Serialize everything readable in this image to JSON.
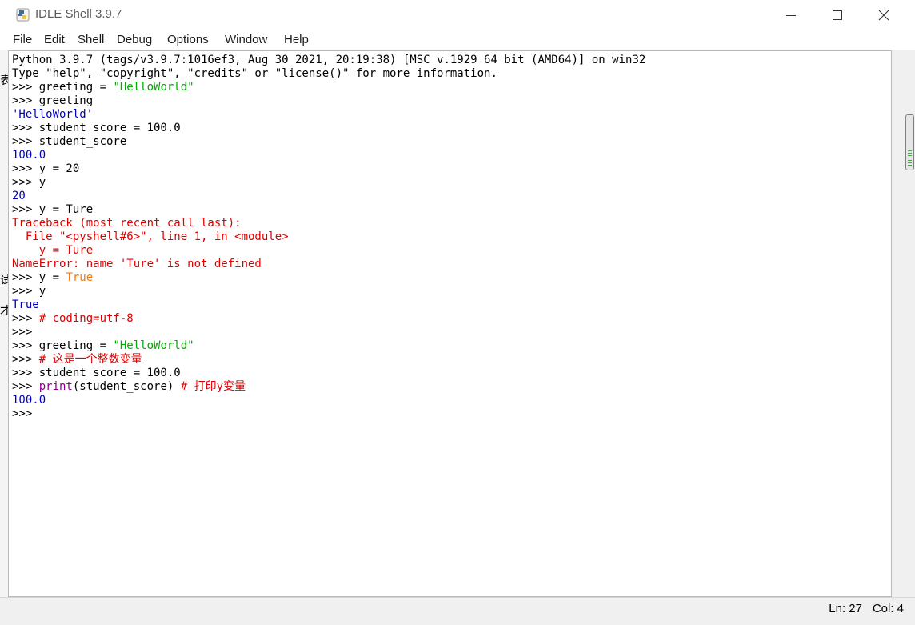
{
  "window": {
    "title": "IDLE Shell 3.9.7"
  },
  "menu": [
    "File",
    "Edit",
    "Shell",
    "Debug",
    "Options",
    "Window",
    "Help"
  ],
  "shell": {
    "lines": [
      [
        {
          "t": "Python 3.9.7 (tags/v3.9.7:1016ef3, Aug 30 2021, 20:19:38) [MSC v.1929 64 bit (AMD64)] on win32",
          "c": "code"
        }
      ],
      [
        {
          "t": "Type \"help\", \"copyright\", \"credits\" or \"license()\" for more information.",
          "c": "code"
        }
      ],
      [
        {
          "t": ">>> ",
          "c": "prompt"
        },
        {
          "t": "greeting = ",
          "c": "code"
        },
        {
          "t": "\"HelloWorld\"",
          "c": "str"
        }
      ],
      [
        {
          "t": ">>> ",
          "c": "prompt"
        },
        {
          "t": "greeting",
          "c": "code"
        }
      ],
      [
        {
          "t": "'HelloWorld'",
          "c": "out"
        }
      ],
      [
        {
          "t": ">>> ",
          "c": "prompt"
        },
        {
          "t": "student_score = 100.0",
          "c": "code"
        }
      ],
      [
        {
          "t": ">>> ",
          "c": "prompt"
        },
        {
          "t": "student_score",
          "c": "code"
        }
      ],
      [
        {
          "t": "100.0",
          "c": "out"
        }
      ],
      [
        {
          "t": ">>> ",
          "c": "prompt"
        },
        {
          "t": "y = 20",
          "c": "code"
        }
      ],
      [
        {
          "t": ">>> ",
          "c": "prompt"
        },
        {
          "t": "y",
          "c": "code"
        }
      ],
      [
        {
          "t": "20",
          "c": "out"
        }
      ],
      [
        {
          "t": ">>> ",
          "c": "prompt"
        },
        {
          "t": "y = Ture",
          "c": "code"
        }
      ],
      [
        {
          "t": "Traceback (most recent call last):",
          "c": "err"
        }
      ],
      [
        {
          "t": "  File \"<pyshell#6>\", line 1, in <module>",
          "c": "err"
        }
      ],
      [
        {
          "t": "    y = Ture",
          "c": "err"
        }
      ],
      [
        {
          "t": "NameError: name 'Ture' is not defined",
          "c": "err"
        }
      ],
      [
        {
          "t": ">>> ",
          "c": "prompt"
        },
        {
          "t": "y = ",
          "c": "code"
        },
        {
          "t": "True",
          "c": "kw"
        }
      ],
      [
        {
          "t": ">>> ",
          "c": "prompt"
        },
        {
          "t": "y",
          "c": "code"
        }
      ],
      [
        {
          "t": "True",
          "c": "out"
        }
      ],
      [
        {
          "t": ">>> ",
          "c": "prompt"
        },
        {
          "t": "# coding=utf-8",
          "c": "cm"
        }
      ],
      [
        {
          "t": ">>> ",
          "c": "prompt"
        }
      ],
      [
        {
          "t": ">>> ",
          "c": "prompt"
        },
        {
          "t": "greeting = ",
          "c": "code"
        },
        {
          "t": "\"HelloWorld\"",
          "c": "str"
        }
      ],
      [
        {
          "t": ">>> ",
          "c": "prompt"
        },
        {
          "t": "# 这是一个整数变量",
          "c": "cm"
        }
      ],
      [
        {
          "t": ">>> ",
          "c": "prompt"
        },
        {
          "t": "student_score = 100.0",
          "c": "code"
        }
      ],
      [
        {
          "t": ">>> ",
          "c": "prompt"
        },
        {
          "t": "print",
          "c": "bi"
        },
        {
          "t": "(student_score) ",
          "c": "code"
        },
        {
          "t": "# 打印y变量",
          "c": "cm"
        }
      ],
      [
        {
          "t": "100.0",
          "c": "out"
        }
      ],
      [
        {
          "t": ">>> ",
          "c": "prompt"
        }
      ]
    ]
  },
  "status": {
    "line": "Ln: 27",
    "col": "Col: 4"
  },
  "left_edge_chars": [
    "表",
    "试",
    "才"
  ],
  "colors": {
    "string": "#00aa00",
    "output": "#0000c0",
    "error": "#dd0000",
    "keyword": "#ff7700",
    "builtin": "#900090"
  },
  "icons": {
    "app": "python-idle-icon",
    "minimize": "minimize-icon",
    "maximize": "maximize-icon",
    "close": "close-icon"
  }
}
